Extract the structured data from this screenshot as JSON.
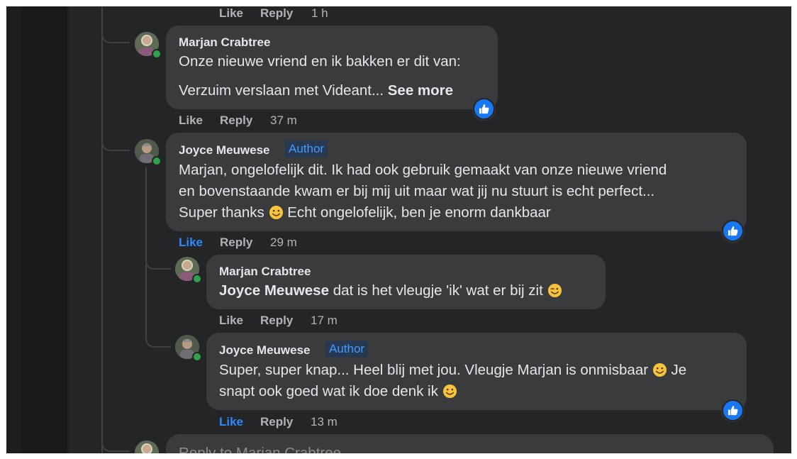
{
  "top_actions": {
    "like": "Like",
    "reply": "Reply",
    "time": "1 h"
  },
  "comments": [
    {
      "author": "Marjan Crabtree",
      "line1": "Onze nieuwe vriend en ik bakken er dit van:",
      "line2": "Verzuim verslaan met Videant...",
      "see_more": "See more",
      "like": "Like",
      "reply": "Reply",
      "time": "37 m",
      "reaction": "like"
    },
    {
      "author": "Joyce Meuwese",
      "badge": "Author",
      "line1": "Marjan, ongelofelijk dit. Ik had ook gebruik gemaakt van onze nieuwe vriend",
      "line2": "en bovenstaande kwam er bij mij uit maar wat jij nu stuurt is echt perfect...",
      "line3a": "Super thanks",
      "line3b": "Echt ongelofelijk, ben je enorm dankbaar",
      "like": "Like",
      "reply": "Reply",
      "time": "29 m",
      "liked": true,
      "reaction": "like"
    },
    {
      "author": "Marjan Crabtree",
      "mention": "Joyce Meuwese",
      "line1": "dat is het vleugje 'ik' wat er bij zit",
      "like": "Like",
      "reply": "Reply",
      "time": "17 m"
    },
    {
      "author": "Joyce Meuwese",
      "badge": "Author",
      "line1a": "Super, super knap... Heel blij met jou. Vleugje Marjan is onmisbaar",
      "line1b": "Je",
      "line2": "snapt ook goed wat ik doe denk ik",
      "like": "Like",
      "reply": "Reply",
      "time": "13 m",
      "liked": true,
      "reaction": "like"
    }
  ],
  "reply_box": {
    "placeholder": "Reply to Marjan Crabtree"
  },
  "colors": {
    "background": "#242526",
    "bubble": "#3a3b3c",
    "text": "#e4e6eb",
    "muted": "#b0b3b8",
    "accent": "#2d88ff",
    "author_badge_bg": "#263951",
    "online": "#31a24c"
  }
}
